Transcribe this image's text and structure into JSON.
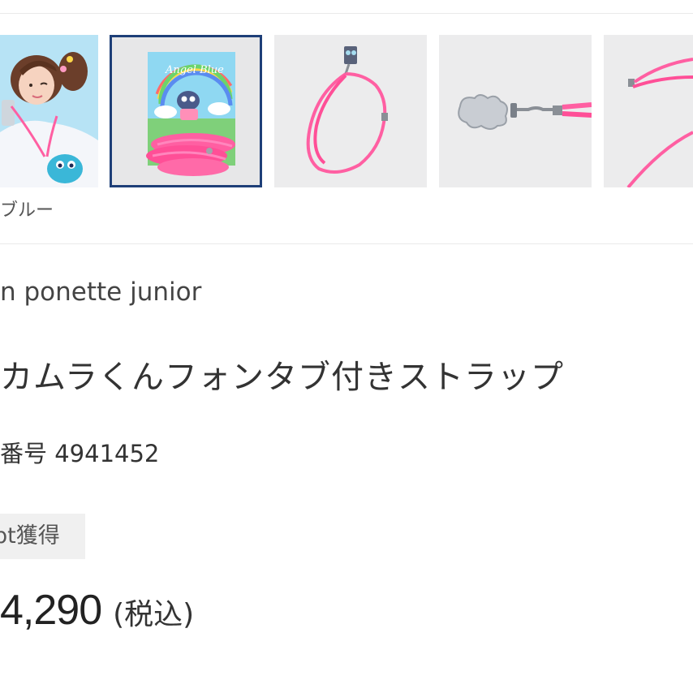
{
  "gallery": {
    "thumbnails": [
      {
        "name": "model-photo"
      },
      {
        "name": "package-photo",
        "package_text": "Angel Blue",
        "selected": true
      },
      {
        "name": "strap-full-photo"
      },
      {
        "name": "strap-clip-photo"
      },
      {
        "name": "strap-partial-photo"
      }
    ],
    "color_caption": "ブルー"
  },
  "product": {
    "brand": "n ponette junior",
    "title": "カムラくんフォンタブ付きストラップ",
    "number": "番号 4941452",
    "points_badge": "pt獲得",
    "price": "4,290",
    "tax_note": "(税込)"
  },
  "colors": {
    "selected_border": "#1e3f78",
    "strap_pink": "#ff5fa2",
    "badge_bg": "#f0f0f0"
  }
}
